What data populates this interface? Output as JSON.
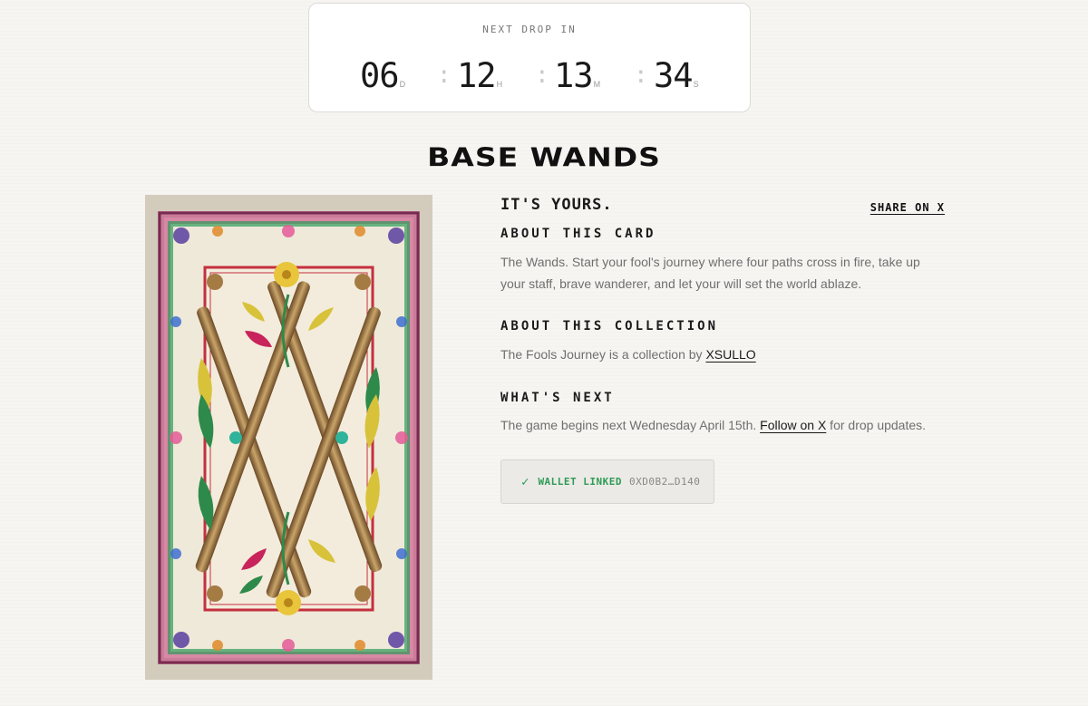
{
  "countdown": {
    "label": "NEXT DROP IN",
    "days": "06",
    "days_suffix": "D",
    "hours": "12",
    "hours_suffix": "H",
    "minutes": "13",
    "minutes_suffix": "M",
    "seconds": "34",
    "seconds_suffix": "S",
    "separator": ":"
  },
  "title": "BASE WANDS",
  "card": {
    "image_alt": "Tarot card illustration of crossed wands with floral border"
  },
  "info": {
    "headline": "IT'S YOURS.",
    "share_label": "SHARE ON X",
    "about_card_heading": "ABOUT THIS CARD",
    "about_card_text": "The Wands. Start your fool's journey where four paths cross in fire, take up your staff, brave wanderer, and let your will set the world ablaze.",
    "about_collection_heading": "ABOUT THIS COLLECTION",
    "about_collection_prefix": "The Fools Journey is a collection by ",
    "about_collection_link": "XSULLO",
    "whats_next_heading": "WHAT'S NEXT",
    "whats_next_prefix": "The game begins next Wednesday April 15th. ",
    "whats_next_link": "Follow on X",
    "whats_next_suffix": " for drop updates."
  },
  "wallet": {
    "check_icon": "check-icon",
    "status": "WALLET LINKED",
    "address": "0XD0B2…D140",
    "status_color": "#2f9b55"
  }
}
